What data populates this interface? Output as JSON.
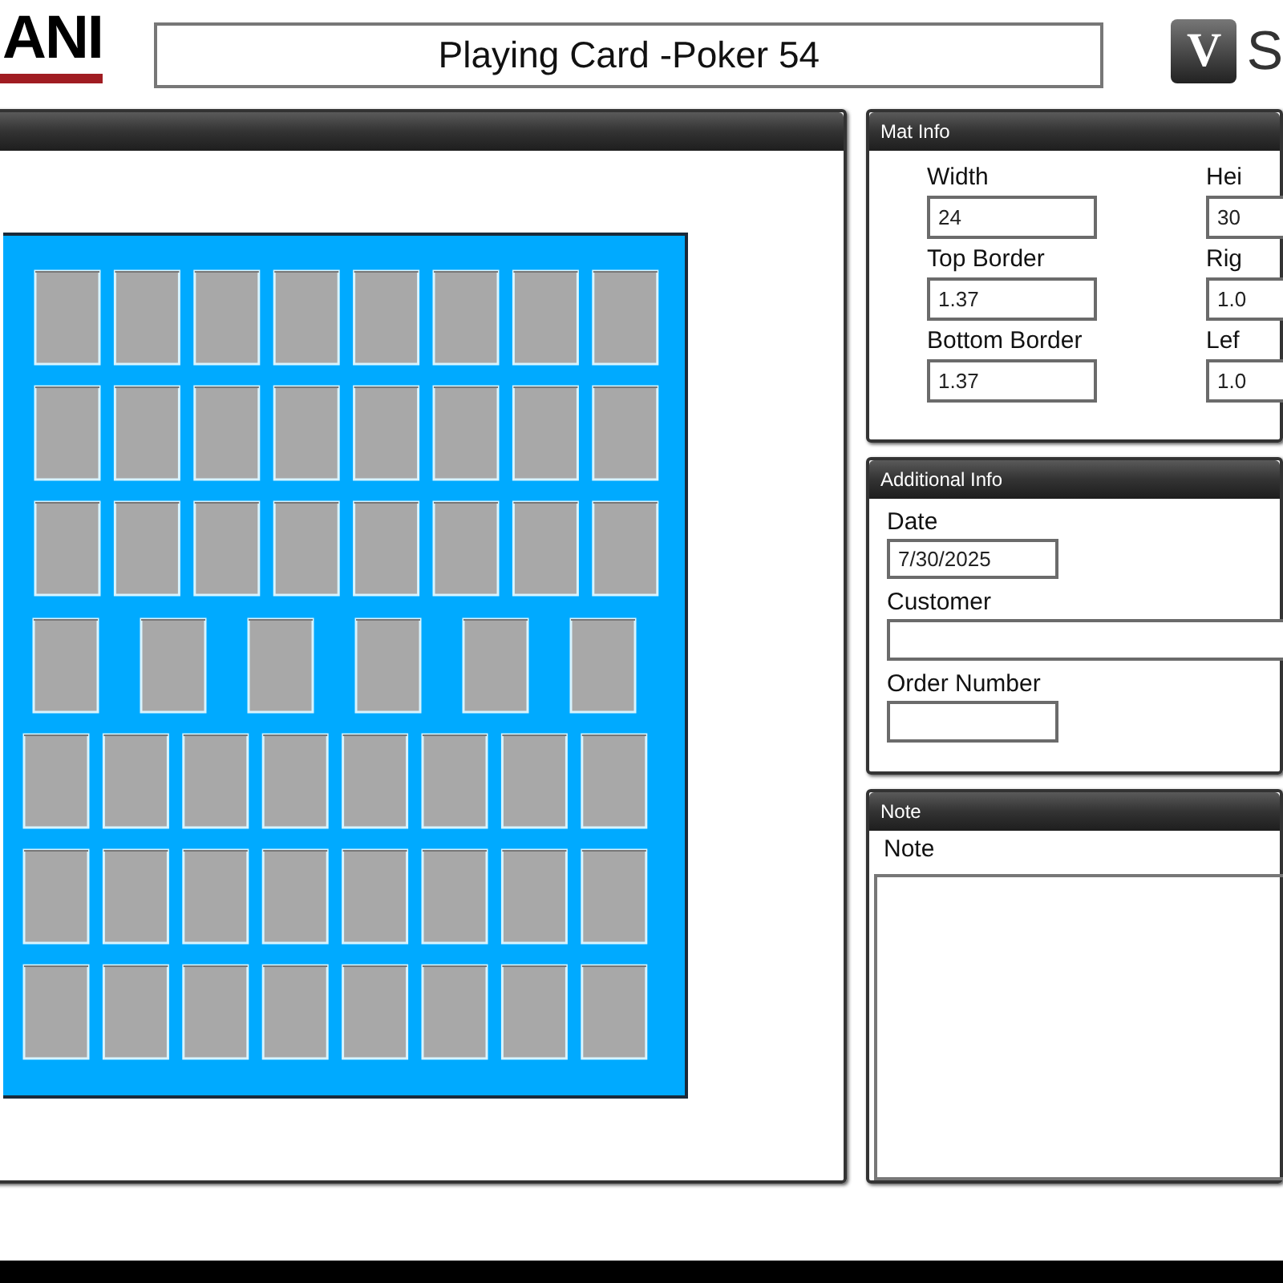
{
  "header": {
    "logo_text": "ANI",
    "title": "Playing Card -Poker 54",
    "badge_letter": "V",
    "brand_text": "S"
  },
  "mat_info": {
    "title": "Mat Info",
    "fields": [
      {
        "label": "Width",
        "value": "24"
      },
      {
        "label": "Hei",
        "value": "30"
      },
      {
        "label": "Top Border",
        "value": "1.37"
      },
      {
        "label": "Rig",
        "value": "1.0"
      },
      {
        "label": "Bottom Border",
        "value": "1.37"
      },
      {
        "label": "Lef",
        "value": "1.0"
      }
    ]
  },
  "additional_info": {
    "title": "Additional Info",
    "fields": [
      {
        "label": "Date",
        "value": "7/30/2025",
        "kind": "short"
      },
      {
        "label": "Customer",
        "kind": "wide"
      },
      {
        "label": "Order Number",
        "kind": "short"
      }
    ]
  },
  "note": {
    "title": "Note",
    "label": "Note"
  }
}
